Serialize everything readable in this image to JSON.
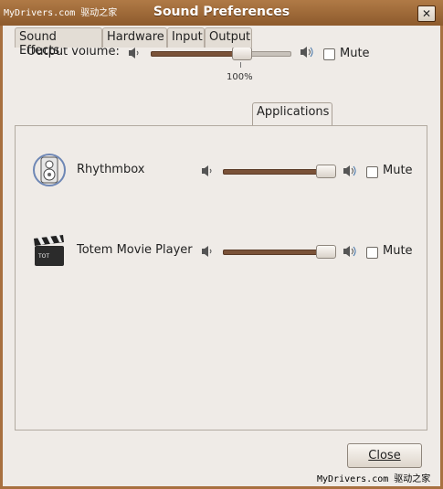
{
  "window": {
    "title": "Sound Preferences",
    "watermark_text": "MyDrivers.com 驱动之家"
  },
  "output": {
    "label": "Output volume:",
    "value_text": "100%",
    "level": 0.64,
    "mute_label": "Mute",
    "muted": false
  },
  "tabs": [
    {
      "label": "Sound Effects"
    },
    {
      "label": "Hardware"
    },
    {
      "label": "Input"
    },
    {
      "label": "Output"
    },
    {
      "label": "Applications",
      "active": true
    }
  ],
  "applications": [
    {
      "name": "Rhythmbox",
      "icon": "speaker-app-icon",
      "level": 1.0,
      "mute_label": "Mute",
      "muted": false
    },
    {
      "name": "Totem Movie Player",
      "icon": "clapperboard-icon",
      "level": 1.0,
      "mute_label": "Mute",
      "muted": false
    }
  ],
  "buttons": {
    "close_label": "Close",
    "close_icon": "close-icon"
  },
  "colors": {
    "titlebar": "#9a6636",
    "window_bg": "#efebe7",
    "slider_fill": "#7a5238"
  }
}
